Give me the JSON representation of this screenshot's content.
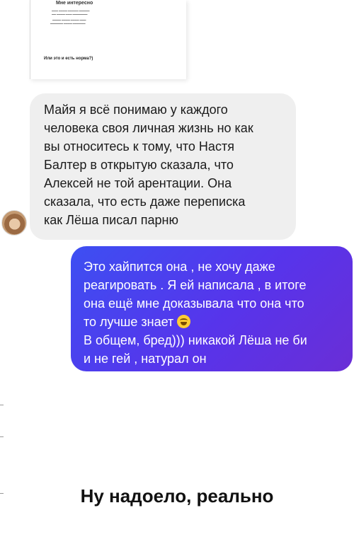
{
  "quote": {
    "title": "Мне интересно",
    "footer": "Или это и есть норма?)"
  },
  "incoming_message": {
    "text": "Майя я всё понимаю у каждого\nчеловека своя личная жизнь но как\nвы относитесь к тому, что Настя\nБалтер в открытую сказала, что\nАлексей не той арентации. Она\nсказала, что есть даже переписка\nкак Лёша писал парню"
  },
  "outgoing_message": {
    "text_before_emoji": "Это хайпится она  , не хочу даже\nреагировать . Я ей написала , в итоге\nона ещё мне доказывала что она что\nто лучше знает ",
    "emoji": "face-with-tears-of-joy-icon",
    "text_after_emoji": "\nВ общем, бред))) никакой Лёша не би\nи не гей , натурал он"
  },
  "caption": "Ну надоело, реально",
  "colors": {
    "incoming_bubble": "#efefef",
    "outgoing_gradient_start": "#3d4ff2",
    "outgoing_gradient_end": "#6a2ed6",
    "caption_text": "#111111"
  }
}
